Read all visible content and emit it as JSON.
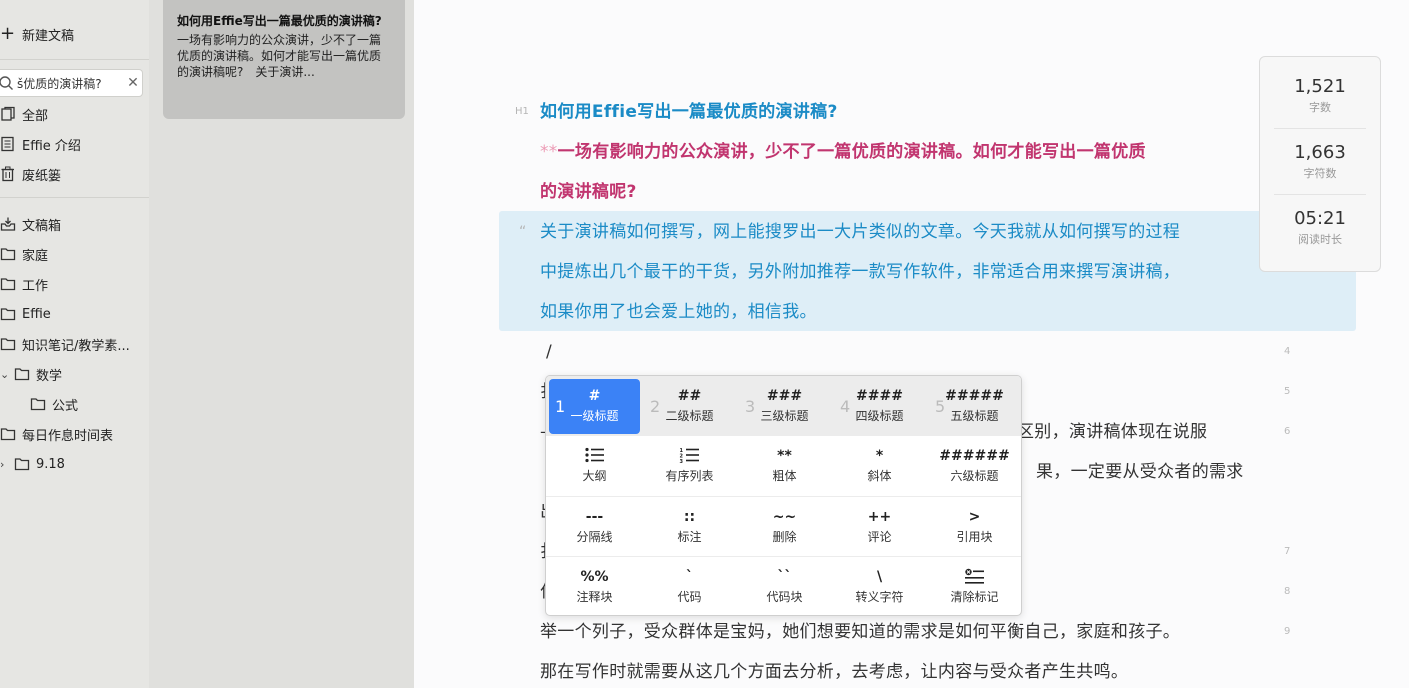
{
  "sidebar": {
    "new_doc": "新建文稿",
    "search_value": "š优质的演讲稿?",
    "items": [
      {
        "label": "全部"
      },
      {
        "label": "Effie 介绍"
      },
      {
        "label": "废纸篓"
      },
      {
        "label": "文稿箱"
      },
      {
        "label": "家庭"
      },
      {
        "label": "工作"
      },
      {
        "label": "Effie"
      },
      {
        "label": "知识笔记/教学素..."
      },
      {
        "label": "数学"
      },
      {
        "label": "公式"
      },
      {
        "label": "每日作息时间表"
      },
      {
        "label": "9.18"
      }
    ]
  },
  "notelist": {
    "card_title": "如何用Effie写出一篇最优质的演讲稿?",
    "card_preview": "一场有影响力的公众演讲，少不了一篇优质的演讲稿。如何才能写出一篇优质的演讲稿呢?　关于演讲..."
  },
  "editor": {
    "h1_marker": "H1",
    "title": "如何用Effie写出一篇最优质的演讲稿?",
    "bold_mark": "**",
    "bold_line1": "一场有影响力的公众演讲，少不了一篇优质的演讲稿。如何才能写出一篇优质",
    "bold_line2": "的演讲稿呢?",
    "quote_mark": "“",
    "quote_line1": "关于演讲稿如何撰写，网上能搜罗出一大片类似的文章。今天我就从如何撰写的过程",
    "quote_line2": "中提炼出几个最干的干货，另外附加推荐一款写作软件，非常适合用来撰写演讲稿，",
    "quote_line3": "如果你用了也会爱上她的，相信我。",
    "slash_line": "/",
    "partial_a": "扌",
    "partial_b1": "区别，演讲稿体现在说服",
    "partial_b0": "—",
    "partial_c1": "果，一定要从受众者的需求",
    "partial_d0": "出",
    "partial_e0": "扌",
    "partial_f0": "仁",
    "body_line1": "举一个列子，受众群体是宝妈，她们想要知道的需求是如何平衡自己，家庭和孩子。",
    "body_line2": "那在写作时就需要从这几个方面去分析，去考虑，让内容与受众者产生共鸣。",
    "line_numbers": [
      "4",
      "5",
      "6",
      "7",
      "8",
      "9"
    ]
  },
  "stats": [
    {
      "value": "1,521",
      "label": "字数"
    },
    {
      "value": "1,663",
      "label": "字符数"
    },
    {
      "value": "05:21",
      "label": "阅读时长"
    }
  ],
  "popup": {
    "rows": [
      [
        {
          "idx": "1",
          "sym": "#",
          "label": "一级标题"
        },
        {
          "idx": "2",
          "sym": "##",
          "label": "二级标题"
        },
        {
          "idx": "3",
          "sym": "###",
          "label": "三级标题"
        },
        {
          "idx": "4",
          "sym": "####",
          "label": "四级标题"
        },
        {
          "idx": "5",
          "sym": "#####",
          "label": "五级标题"
        }
      ],
      [
        {
          "sym": "",
          "label": "大纲"
        },
        {
          "sym": "",
          "label": "有序列表"
        },
        {
          "sym": "**",
          "label": "粗体"
        },
        {
          "sym": "*",
          "label": "斜体"
        },
        {
          "sym": "######",
          "label": "六级标题"
        }
      ],
      [
        {
          "sym": "---",
          "label": "分隔线"
        },
        {
          "sym": "::",
          "label": "标注"
        },
        {
          "sym": "~~",
          "label": "删除"
        },
        {
          "sym": "++",
          "label": "评论"
        },
        {
          "sym": ">",
          "label": "引用块"
        }
      ],
      [
        {
          "sym": "%%",
          "label": "注释块"
        },
        {
          "sym": "`",
          "label": "代码"
        },
        {
          "sym": "``",
          "label": "代码块"
        },
        {
          "sym": "\\",
          "label": "转义字符"
        },
        {
          "sym": "",
          "label": "清除标记"
        }
      ]
    ]
  }
}
